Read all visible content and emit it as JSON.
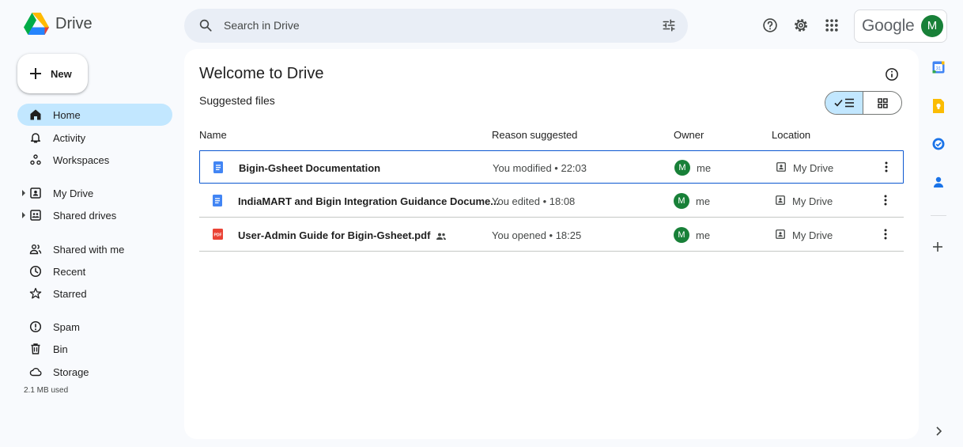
{
  "app": {
    "name": "Drive"
  },
  "search": {
    "placeholder": "Search in Drive",
    "value": ""
  },
  "account": {
    "brand": "Google",
    "avatar_letter": "M",
    "avatar_color": "#188038"
  },
  "new_button": {
    "label": "New"
  },
  "sidebar": {
    "items": [
      {
        "label": "Home",
        "icon": "home-icon",
        "active": true
      },
      {
        "label": "Activity",
        "icon": "bell-icon"
      },
      {
        "label": "Workspaces",
        "icon": "workspaces-icon"
      },
      {
        "label": "My Drive",
        "icon": "my-drive-icon",
        "expandable": true
      },
      {
        "label": "Shared drives",
        "icon": "shared-drives-icon",
        "expandable": true
      },
      {
        "label": "Shared with me",
        "icon": "people-icon"
      },
      {
        "label": "Recent",
        "icon": "clock-icon"
      },
      {
        "label": "Starred",
        "icon": "star-icon"
      },
      {
        "label": "Spam",
        "icon": "spam-icon"
      },
      {
        "label": "Bin",
        "icon": "bin-icon"
      },
      {
        "label": "Storage",
        "icon": "cloud-icon"
      }
    ],
    "storage_used": "2.1 MB used"
  },
  "main": {
    "title": "Welcome to Drive",
    "section_title": "Suggested files",
    "columns": {
      "name": "Name",
      "reason": "Reason suggested",
      "owner": "Owner",
      "location": "Location"
    },
    "files": [
      {
        "name": "Bigin-Gsheet Documentation",
        "type": "doc",
        "reason": "You modified • 22:03",
        "owner": "me",
        "owner_letter": "M",
        "location": "My Drive",
        "selected": true,
        "shared": false
      },
      {
        "name": "IndiaMART and Bigin Integration Guidance Docume...",
        "type": "doc",
        "reason": "You edited • 18:08",
        "owner": "me",
        "owner_letter": "M",
        "location": "My Drive",
        "selected": false,
        "shared": false
      },
      {
        "name": "User-Admin Guide for Bigin-Gsheet.pdf",
        "type": "pdf",
        "reason": "You opened • 18:25",
        "owner": "me",
        "owner_letter": "M",
        "location": "My Drive",
        "selected": false,
        "shared": true
      }
    ]
  },
  "colors": {
    "accent": "#0b57d0",
    "active_nav": "#c2e7ff",
    "doc_blue": "#4285f4",
    "pdf_red": "#ea4335"
  }
}
